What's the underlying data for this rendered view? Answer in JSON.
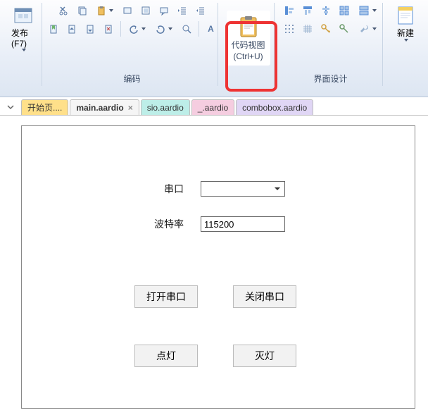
{
  "ribbon": {
    "publish_label": "发布(F7)",
    "group_encoding": "编码",
    "group_uidesign": "界面设计",
    "code_view_label": "代码视图",
    "code_view_shortcut": "(Ctrl+U)",
    "new_label": "新建"
  },
  "tabs": [
    {
      "label": "开始页....",
      "kind": "yellow",
      "closable": false
    },
    {
      "label": "main.aardio",
      "kind": "active",
      "closable": true
    },
    {
      "label": "sio.aardio",
      "kind": "teal",
      "closable": false
    },
    {
      "label": "_.aardio",
      "kind": "pink",
      "closable": false
    },
    {
      "label": "combobox.aardio",
      "kind": "lav",
      "closable": false
    }
  ],
  "form": {
    "serial_label": "串口",
    "serial_value": "",
    "baud_label": "波特率",
    "baud_value": "115200",
    "btn_open": "打开串口",
    "btn_close": "关闭串口",
    "btn_on": "点灯",
    "btn_off": "灭灯"
  }
}
